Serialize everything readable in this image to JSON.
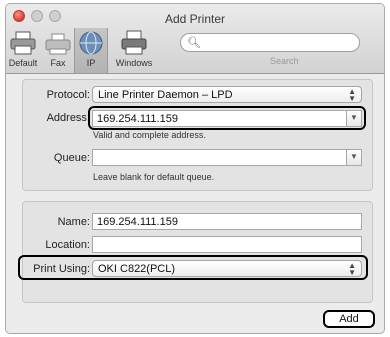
{
  "window": {
    "title": "Add Printer"
  },
  "toolbar": {
    "items": [
      {
        "label": "Default",
        "icon": "printer-icon"
      },
      {
        "label": "Fax",
        "icon": "fax-icon"
      },
      {
        "label": "IP",
        "icon": "globe-icon",
        "selected": true
      },
      {
        "label": "Windows",
        "icon": "windows-printer-icon"
      }
    ],
    "search_label": "Search"
  },
  "connection": {
    "protocol_label": "Protocol:",
    "protocol_value": "Line Printer Daemon – LPD",
    "address_label": "Address:",
    "address_value": "169.254.111.159",
    "address_hint": "Valid and complete address.",
    "queue_label": "Queue:",
    "queue_value": "",
    "queue_hint": "Leave blank for default queue."
  },
  "details": {
    "name_label": "Name:",
    "name_value": "169.254.111.159",
    "location_label": "Location:",
    "location_value": "",
    "print_using_label": "Print Using:",
    "print_using_value": "OKI C822(PCL)"
  },
  "actions": {
    "add_label": "Add"
  },
  "colors": {
    "close": "#e0443e",
    "callout": "#000000"
  }
}
